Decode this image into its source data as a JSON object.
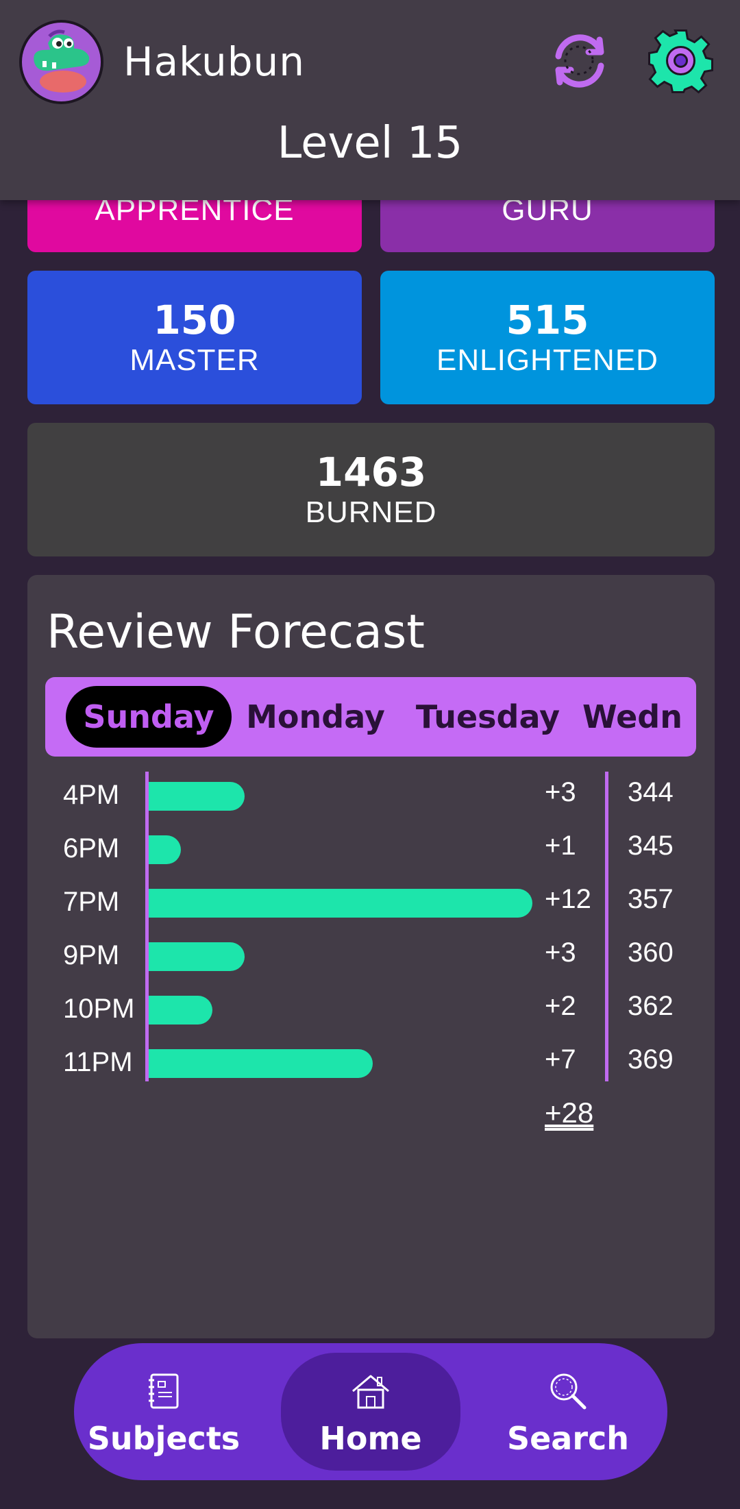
{
  "header": {
    "username": "Hakubun",
    "level": "Level 15"
  },
  "srs": {
    "apprentice": {
      "label": "APPRENTICE"
    },
    "guru": {
      "label": "GURU"
    },
    "master": {
      "count": "150",
      "label": "MASTER"
    },
    "enlightened": {
      "count": "515",
      "label": "ENLIGHTENED"
    },
    "burned": {
      "count": "1463",
      "label": "BURNED"
    }
  },
  "forecast": {
    "title": "Review Forecast",
    "tabs": [
      "Sunday",
      "Monday",
      "Tuesday",
      "Wedn"
    ],
    "active_tab": "Sunday",
    "rows": [
      {
        "time": "4PM",
        "added": "+3",
        "cumulative": "344",
        "value": 3
      },
      {
        "time": "6PM",
        "added": "+1",
        "cumulative": "345",
        "value": 1
      },
      {
        "time": "7PM",
        "added": "+12",
        "cumulative": "357",
        "value": 12
      },
      {
        "time": "9PM",
        "added": "+3",
        "cumulative": "360",
        "value": 3
      },
      {
        "time": "10PM",
        "added": "+2",
        "cumulative": "362",
        "value": 2
      },
      {
        "time": "11PM",
        "added": "+7",
        "cumulative": "369",
        "value": 7
      }
    ],
    "total": "+28"
  },
  "nav": {
    "subjects": "Subjects",
    "home": "Home",
    "search": "Search",
    "active": "Home"
  },
  "colors": {
    "bar": "#1de5ab",
    "accent": "#c56bf5",
    "apprentice": "#e0099f",
    "guru": "#8a2fa8",
    "master": "#2b4fdb",
    "enlightened": "#0094dd",
    "burned": "#414041"
  },
  "icons": {
    "avatar": "crocodile-avatar",
    "sync": "sync-icon",
    "settings": "gear-icon",
    "subjects": "notebook-icon",
    "home": "house-icon",
    "search": "magnifier-icon"
  }
}
